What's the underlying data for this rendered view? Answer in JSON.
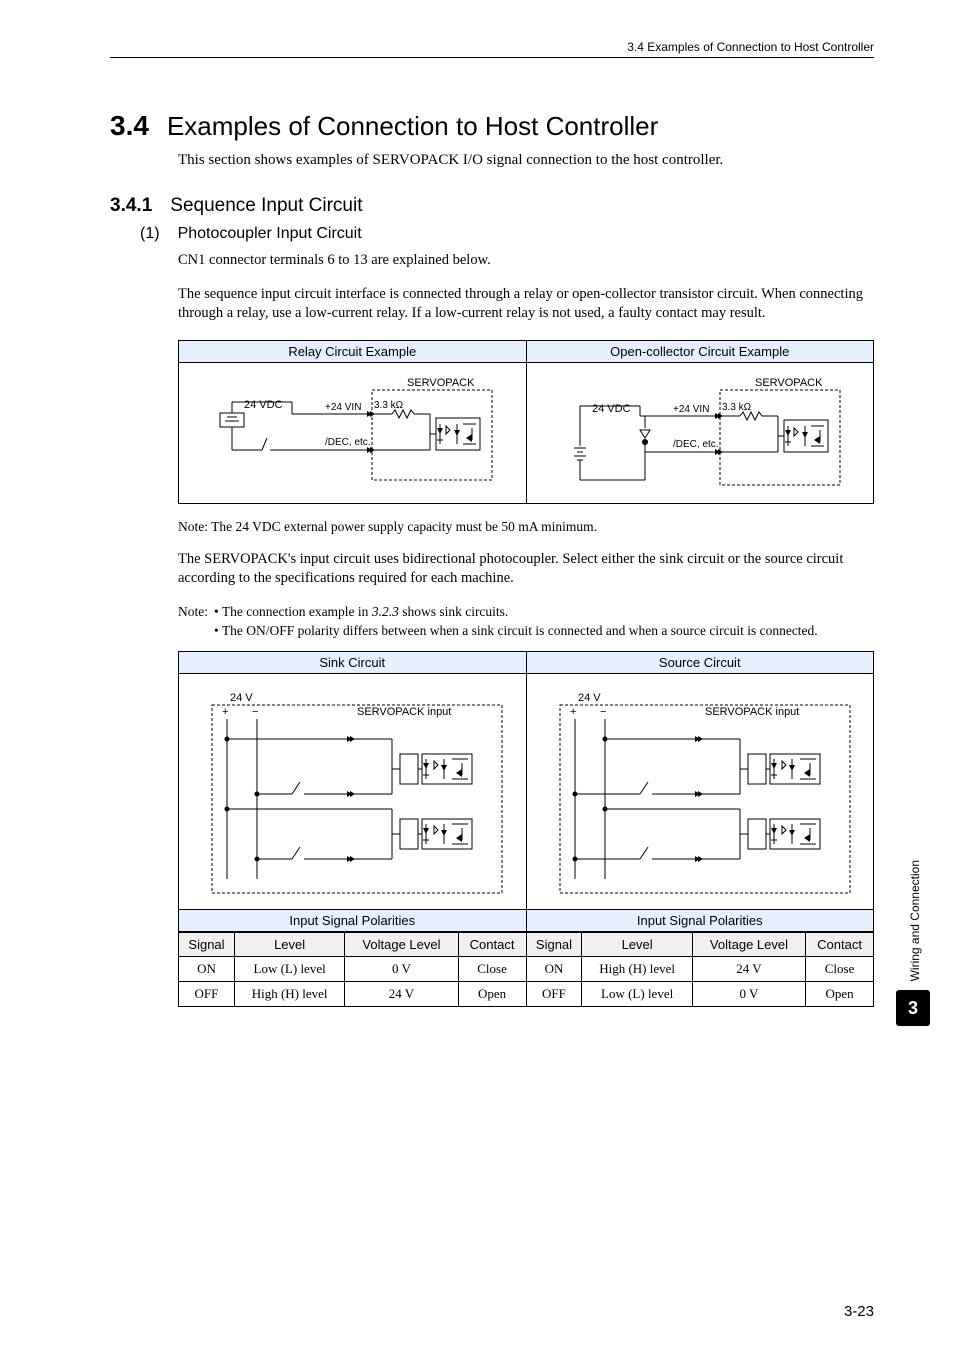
{
  "header": {
    "breadcrumb": "3.4  Examples of Connection to Host Controller"
  },
  "section": {
    "number": "3.4",
    "title": "Examples of Connection to Host Controller",
    "intro": "This section shows examples of SERVOPACK I/O signal connection to the host controller."
  },
  "subsection": {
    "number": "3.4.1",
    "title": "Sequence Input Circuit"
  },
  "part": {
    "number": "(1)",
    "title": "Photocoupler Input Circuit"
  },
  "para1": "CN1 connector terminals 6 to 13 are explained below.",
  "para2": "The sequence input circuit interface is connected through a relay or open-collector transistor circuit. When connecting through a relay, use a low-current relay. If a low-current relay is not used, a faulty contact may result.",
  "diagrams1": {
    "left_title": "Relay Circuit Example",
    "right_title": "Open-collector Circuit Example",
    "labels": {
      "servopack": "SERVOPACK",
      "vdc": "24 VDC",
      "vin": "+24 VIN",
      "res": "3.3 kΩ",
      "dec": "/DEC, etc."
    }
  },
  "note1": "Note: The 24 VDC external power supply capacity must be 50 mA minimum.",
  "para3": "The SERVOPACK's input circuit uses bidirectional photocoupler. Select either the sink circuit or the source circuit according to the specifications required for each machine.",
  "note2": {
    "label": "Note:",
    "items": [
      "The connection example in 3.2.3 shows sink circuits.",
      "The ON/OFF polarity differs between when a sink circuit is connected and when a source circuit is connected."
    ]
  },
  "diagrams2": {
    "left_title": "Sink Circuit",
    "right_title": "Source Circuit",
    "labels": {
      "v24": "24 V",
      "plus": "+",
      "minus": "−",
      "sp_input": "SERVOPACK input"
    },
    "pol_title": "Input Signal Polarities",
    "headers": [
      "Signal",
      "Level",
      "Voltage Level",
      "Contact"
    ],
    "sink_rows": [
      [
        "ON",
        "Low (L) level",
        "0 V",
        "Close"
      ],
      [
        "OFF",
        "High (H) level",
        "24 V",
        "Open"
      ]
    ],
    "source_rows": [
      [
        "ON",
        "High (H) level",
        "24 V",
        "Close"
      ],
      [
        "OFF",
        "Low (L) level",
        "0 V",
        "Open"
      ]
    ]
  },
  "side": {
    "chapter_name": "Wiring and Connection",
    "chapter_num": "3"
  },
  "page_number": "3-23"
}
